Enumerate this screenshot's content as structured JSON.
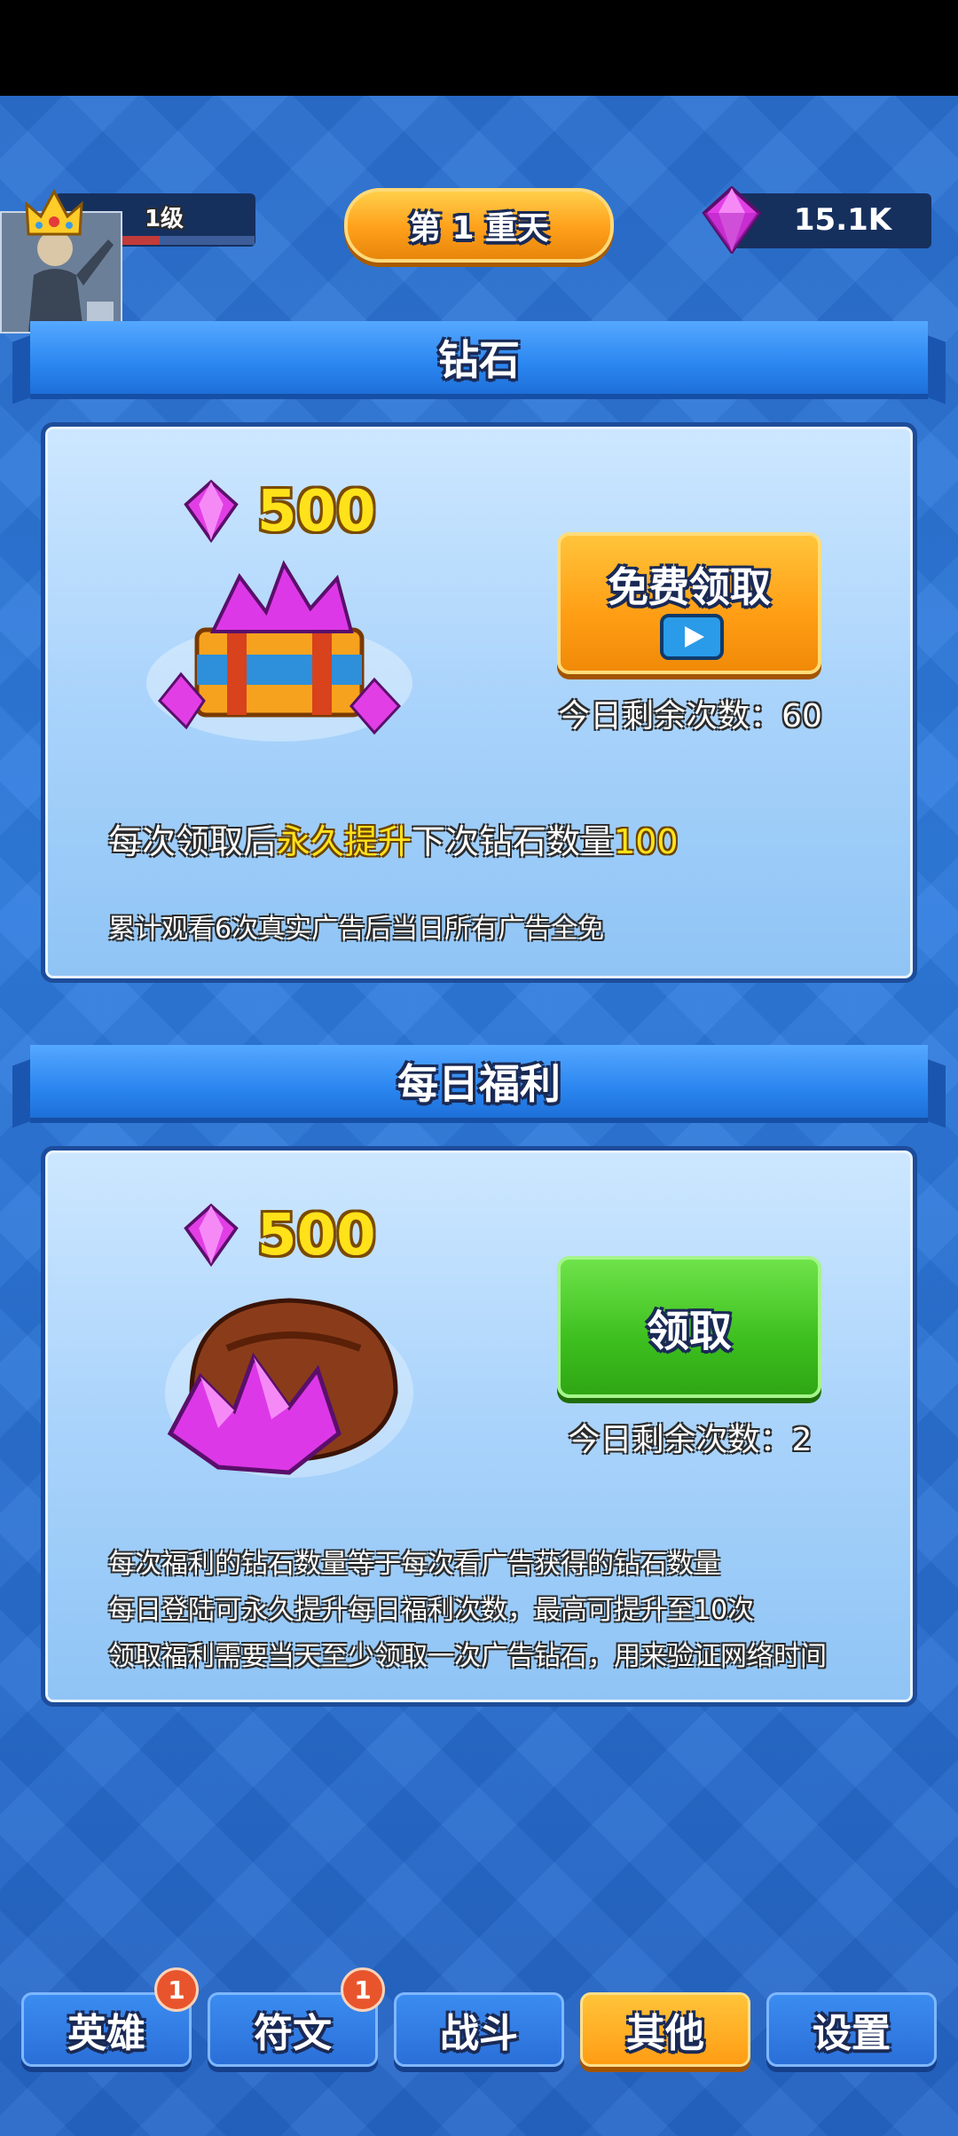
{
  "player": {
    "level_label": "1级",
    "level_progress": 0.34
  },
  "header": {
    "stage_label": "第 1 重天"
  },
  "currency": {
    "gems": "15.1K"
  },
  "diamond_section": {
    "title": "钻石",
    "reward_amount": "500",
    "button_label": "免费领取",
    "remaining_label": "今日剩余次数：60",
    "desc_prefix": "每次领取后",
    "desc_highlight": "永久提升",
    "desc_middle": "下次钻石数量",
    "desc_value": "100",
    "note": "累计观看6次真实广告后当日所有广告全免"
  },
  "daily_section": {
    "title": "每日福利",
    "reward_amount": "500",
    "button_label": "领取",
    "remaining_label": "今日剩余次数：2",
    "lines": [
      "每次福利的钻石数量等于每次看广告获得的钻石数量",
      "每日登陆可永久提升每日福利次数，最高可提升至10次",
      "领取福利需要当天至少领取一次广告钻石，用来验证网络时间"
    ]
  },
  "nav": {
    "items": [
      {
        "label": "英雄",
        "badge": "1"
      },
      {
        "label": "符文",
        "badge": "1"
      },
      {
        "label": "战斗"
      },
      {
        "label": "其他"
      },
      {
        "label": "设置"
      }
    ]
  },
  "icons": {
    "gem": "gem-icon",
    "crown": "crown-icon",
    "video": "video-play-icon",
    "treasure_chest": "gem-chest-icon",
    "gem_sack": "gem-sack-icon"
  },
  "colors": {
    "accent_orange": "#ff9d14",
    "accent_green": "#3dbf1e",
    "highlight_yellow": "#ffe21a",
    "gem_pink": "#e040e0"
  }
}
